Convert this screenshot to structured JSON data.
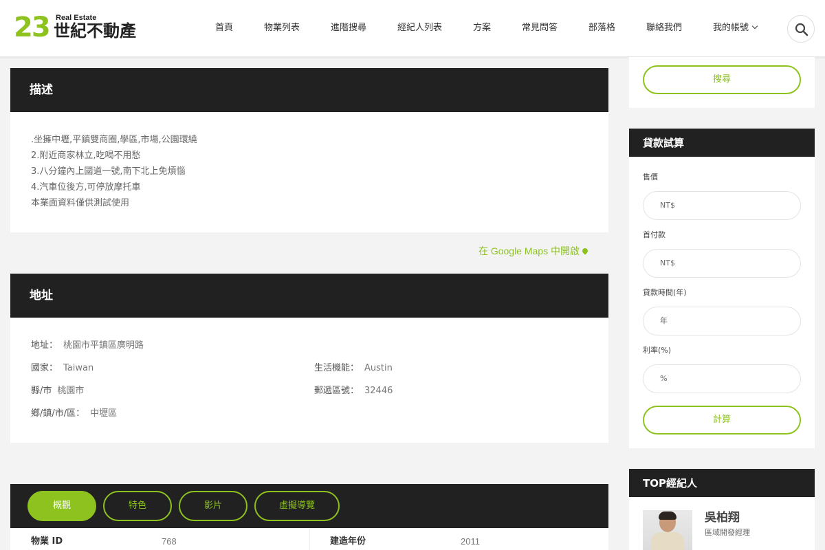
{
  "header": {
    "logo": {
      "number": "23",
      "subtitle": "Real Estate",
      "name": "世紀不動產"
    },
    "nav": [
      "首頁",
      "物業列表",
      "進階搜尋",
      "經紀人列表",
      "方案",
      "常見問答",
      "部落格",
      "聯絡我們",
      "我的帳號"
    ],
    "search_icon": "search-icon"
  },
  "description": {
    "title": "描述",
    "lines": [
      ".坐擁中壢,平鎮雙商圈,學區,市場,公園環繞",
      "2.附近商家林立,吃喝不用愁",
      "3.八分鐘內上國道一號,南下北上免煩惱",
      "4.汽車位後方,可停放摩托車",
      "本業面資料僅供測試使用"
    ]
  },
  "google_maps_link": "在 Google Maps 中開啟",
  "address": {
    "title": "地址",
    "rows": [
      {
        "label": "地址：",
        "value": "桃園市平鎮區廣明路"
      },
      {
        "label": "國家：",
        "value": "Taiwan"
      },
      {
        "label": "生活機能：",
        "value": "Austin"
      },
      {
        "label": "縣/市",
        "value": "桃園市"
      },
      {
        "label": "郵遞區號：",
        "value": "32446"
      },
      {
        "label": "鄉/鎮/市/區：",
        "value": "中壢區"
      }
    ]
  },
  "tabs": [
    "概觀",
    "特色",
    "影片",
    "虛擬導覽"
  ],
  "overview": [
    {
      "label": "物業 ID",
      "value": "768"
    },
    {
      "label": "建造年份",
      "value": "2011"
    }
  ],
  "sidebar": {
    "search_button": "搜尋",
    "loan_calc": {
      "title": "貸款試算",
      "fields": [
        {
          "label": "售價",
          "placeholder": "NT$"
        },
        {
          "label": "首付款",
          "placeholder": "NT$"
        },
        {
          "label": "貸款時間(年)",
          "placeholder": "年"
        },
        {
          "label": "利率(%)",
          "placeholder": "%"
        }
      ],
      "calc_button": "計算"
    },
    "top_agents": {
      "title": "TOP經紀人",
      "agent": {
        "name": "吳柏翔",
        "title": "區域開發經理"
      }
    }
  },
  "colors": {
    "accent": "#8dc21f",
    "dark": "#212121"
  }
}
